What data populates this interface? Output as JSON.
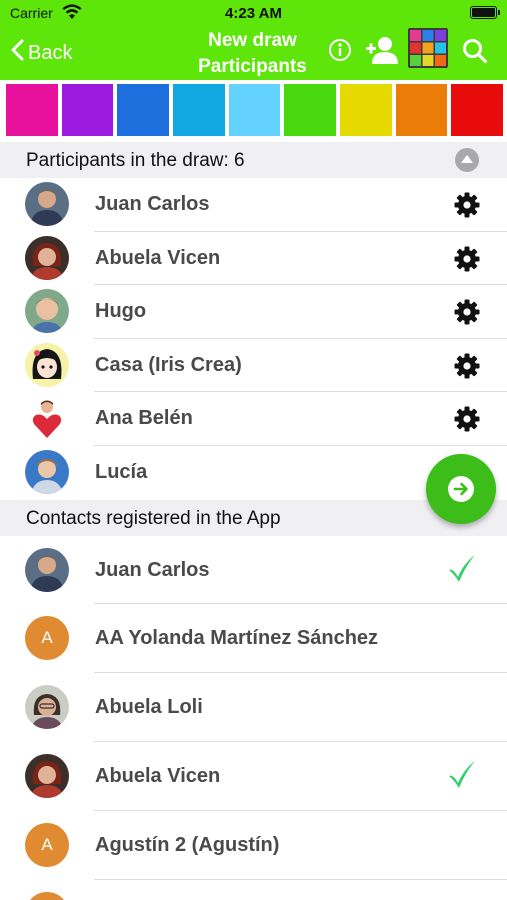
{
  "status_bar": {
    "carrier": "Carrier",
    "time": "4:23 AM"
  },
  "nav": {
    "back_label": "Back",
    "title": "New draw",
    "subtitle": "Participants",
    "bar_color": "#5ee60a",
    "icons": [
      "info-icon",
      "add-person-icon",
      "app-grid-icon",
      "search-icon"
    ]
  },
  "swatches": [
    "#e8119d",
    "#9c19e0",
    "#1c6fdd",
    "#11a7e0",
    "#64d2ff",
    "#47d80d",
    "#e6d900",
    "#eb7c08",
    "#e80b0b"
  ],
  "participants": {
    "header": "Participants in the draw: 6",
    "items": [
      {
        "name": "Juan Carlos"
      },
      {
        "name": "Abuela Vicen"
      },
      {
        "name": "Hugo"
      },
      {
        "name": "Casa (Iris Crea)"
      },
      {
        "name": "Ana Belén"
      },
      {
        "name": "Lucía"
      }
    ]
  },
  "contacts": {
    "header": "Contacts registered in the App",
    "items": [
      {
        "name": "Juan Carlos",
        "selected": true
      },
      {
        "name": "AA Yolanda Martínez Sánchez",
        "initial": "A",
        "selected": false
      },
      {
        "name": "Abuela Loli",
        "selected": false
      },
      {
        "name": "Abuela Vicen",
        "selected": true
      },
      {
        "name": "Agustín 2 (Agustín)",
        "initial": "A",
        "selected": false
      }
    ]
  }
}
